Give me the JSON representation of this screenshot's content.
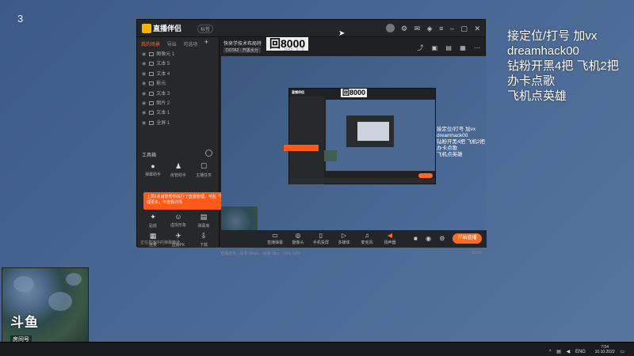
{
  "page": {
    "corner_number": "3"
  },
  "overlay": {
    "lines": [
      "接定位/打号 加vx",
      "dreamhack00",
      "钻粉开黑4把 飞机2把",
      "办卡点歌",
      "飞机点英雄"
    ]
  },
  "app": {
    "logo_text": "直播伴侣",
    "version_badge": "标签",
    "sidebar_tabs": [
      "我的场景",
      "导出",
      "可选项"
    ],
    "sources": [
      {
        "label": "图像元 1"
      },
      {
        "label": "文本 5"
      },
      {
        "label": "文本 4"
      },
      {
        "label": "影元"
      },
      {
        "label": "文本 3"
      },
      {
        "label": "图片 2"
      },
      {
        "label": "文本 1"
      },
      {
        "label": "全屏 1"
      }
    ],
    "tools_header": "工具箱",
    "tools": [
      {
        "label": "弹幕助手",
        "icon": "●"
      },
      {
        "label": "房管助手",
        "icon": "♟"
      },
      {
        "label": "主播任务",
        "icon": "☐"
      },
      {
        "label": "贴纸",
        "icon": "✦"
      },
      {
        "label": "虚拟形象",
        "icon": "☺"
      },
      {
        "label": "弹幕库",
        "icon": "▤"
      },
      {
        "label": "连麦",
        "icon": "▦"
      },
      {
        "label": "直播PK",
        "icon": "✈"
      },
      {
        "label": "下载",
        "icon": "⇩"
      }
    ],
    "tooltip_text": "上周1名房管帮你执行了直播管理，可在「管理更多」中查看详情",
    "sidebar_footer": "正在直播中的弹幕精选",
    "channel_title": "快来学技术布局特",
    "hui_text": "回8000",
    "category": "DOTA2 · 开黑水分",
    "category_extra": "1043 · 6 · 5",
    "bottom_tools": [
      {
        "label": "直播弹幕",
        "icon": "▭"
      },
      {
        "label": "摄像头",
        "icon": "◎"
      },
      {
        "label": "手机投屏",
        "icon": "▯"
      },
      {
        "label": "多媒体",
        "icon": "▷"
      },
      {
        "label": "麦克风",
        "icon": "♫"
      },
      {
        "label": "扬声器",
        "icon": "◀"
      }
    ],
    "start_button": "开始直播",
    "timer": "00:00",
    "status_text": "直播状态 · 码率 0kbps · 帧率 0fps · CPU 12%"
  },
  "nested": {
    "hui_text": "回8000",
    "overlay_lines": [
      "接定位/打号 加vx",
      "dreamhack00",
      "钻粉开黑4把 飞机2把",
      "办卡点歌",
      "飞机点英雄"
    ]
  },
  "stream": {
    "platform_logo": "斗鱼",
    "room_label": "房间号",
    "room_number": "10143950"
  },
  "taskbar": {
    "language": "ENG",
    "time": "7:54",
    "date": "10.10.2022"
  }
}
